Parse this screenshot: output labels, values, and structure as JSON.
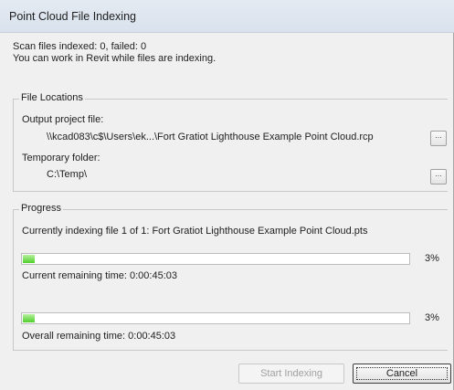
{
  "window": {
    "title": "Point Cloud File Indexing"
  },
  "status": {
    "scan_line": "Scan files indexed: 0, failed: 0",
    "info_line": "You can work in Revit while files are indexing."
  },
  "file_locations": {
    "legend": "File Locations",
    "output_label": "Output project file:",
    "output_value": "\\\\kcad083\\c$\\Users\\ek...\\Fort Gratiot Lighthouse Example Point Cloud.rcp",
    "temp_label": "Temporary folder:",
    "temp_value": "C:\\Temp\\",
    "browse_label": "..."
  },
  "progress": {
    "legend": "Progress",
    "current_file": "Currently indexing file 1 of 1: Fort Gratiot Lighthouse Example Point Cloud.pts",
    "current_percent": 3,
    "current_percent_text": "3%",
    "current_remaining": "Current remaining time: 0:00:45:03",
    "overall_percent": 3,
    "overall_percent_text": "3%",
    "overall_remaining": "Overall remaining time: 0:00:45:03"
  },
  "buttons": {
    "start_label": "Start Indexing",
    "cancel_label": "Cancel"
  },
  "colors": {
    "progress_fill": "#4fcf2a"
  }
}
